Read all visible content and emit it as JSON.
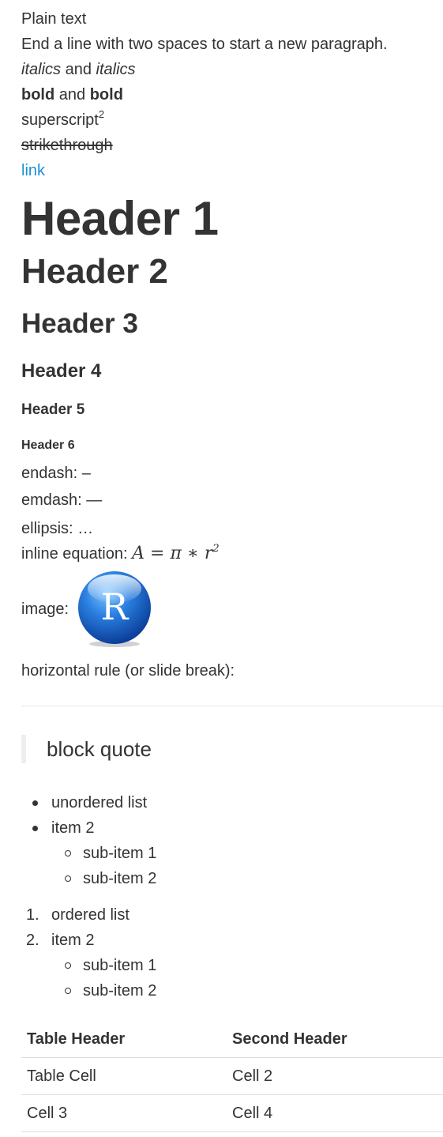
{
  "lines": {
    "plain": "Plain text",
    "end_line": "End a line with two spaces to start a new paragraph.",
    "italics_1": "italics",
    "and": "and",
    "italics_2": "italics",
    "bold_1": "bold",
    "bold_2": "bold",
    "superscript_base": "superscript",
    "superscript_exp": "2",
    "strikethrough": "strikethrough",
    "link": "link"
  },
  "headers": {
    "h1": "Header 1",
    "h2": "Header 2",
    "h3": "Header 3",
    "h4": "Header 4",
    "h5": "Header 5",
    "h6": "Header 6"
  },
  "special": {
    "endash": "endash: –",
    "emdash": "emdash: —",
    "ellipsis": "ellipsis: …",
    "inline_label": "inline equation: ",
    "image_label": "image:",
    "image_letter": "R",
    "hr_label": "horizontal rule (or slide break):"
  },
  "equation": {
    "lhs": "A",
    "eq": "=",
    "pi": "π",
    "star": "∗",
    "r": "r",
    "exp": "2"
  },
  "blockquote": "block quote",
  "unordered": {
    "items": [
      "unordered list",
      "item 2"
    ],
    "subitems": [
      "sub-item 1",
      "sub-item 2"
    ]
  },
  "ordered": {
    "numbers": [
      "1.",
      "2."
    ],
    "items": [
      "ordered list",
      "item 2"
    ],
    "subitems": [
      "sub-item 1",
      "sub-item 2"
    ]
  },
  "table": {
    "headers": [
      "Table Header",
      "Second Header"
    ],
    "rows": [
      [
        "Table Cell",
        "Cell 2"
      ],
      [
        "Cell 3",
        "Cell 4"
      ]
    ]
  },
  "colors": {
    "text": "#333333",
    "link": "#1a8fd6",
    "rule": "#e5e5e5",
    "quote_bar": "#eeeeee",
    "logo_blue": "#1f6fd0"
  },
  "icons": {
    "image": "r-logo-icon"
  }
}
